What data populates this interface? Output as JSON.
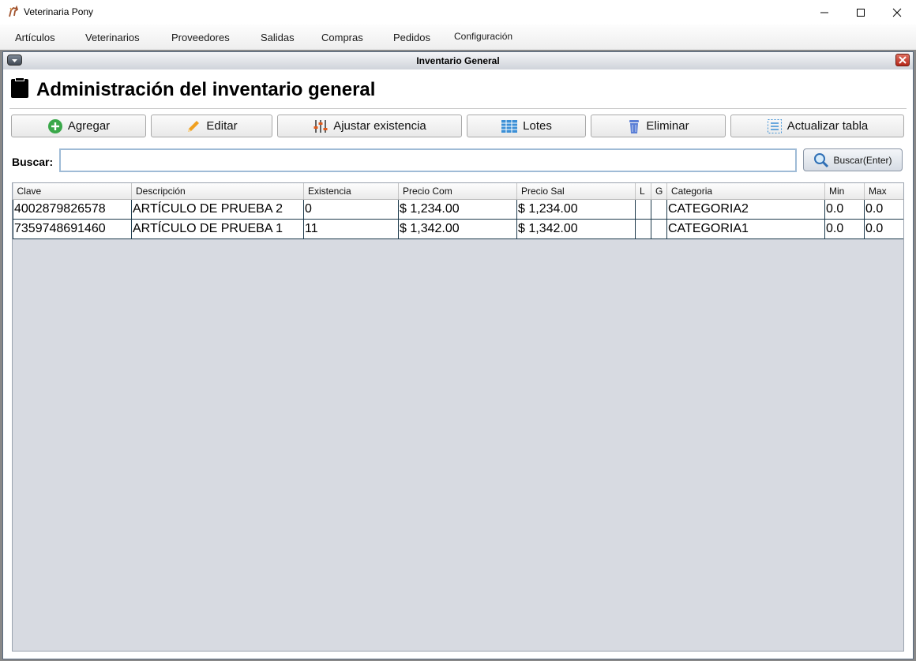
{
  "app": {
    "title": "Veterinaria Pony",
    "icon": "pony-icon"
  },
  "menubar": {
    "items": [
      "Artículos",
      "Veterinarios",
      "Proveedores",
      "Salidas",
      "Compras",
      "Pedidos",
      "Configuración"
    ]
  },
  "internal_frame": {
    "title": "Inventario General"
  },
  "header": {
    "title": "Administración del inventario general",
    "icon": "clipboard-icon"
  },
  "toolbar": {
    "agregar": "Agregar",
    "editar": "Editar",
    "ajustar": "Ajustar existencia",
    "lotes": "Lotes",
    "eliminar": "Eliminar",
    "actualizar": "Actualizar tabla"
  },
  "search": {
    "label": "Buscar:",
    "value": "",
    "button": "Buscar(Enter)"
  },
  "table": {
    "columns": [
      "Clave",
      "Descripción",
      "Existencia",
      "Precio Com",
      "Precio Sal",
      "L",
      "G",
      "Categoria",
      "Min",
      "Max"
    ],
    "rows": [
      [
        "4002879826578",
        "ARTÍCULO DE PRUEBA 2",
        "0",
        "$ 1,234.00",
        "$ 1,234.00",
        "",
        "",
        "CATEGORIA2",
        "0.0",
        "0.0"
      ],
      [
        "7359748691460",
        "ARTÍCULO DE PRUEBA 1",
        "11",
        "$ 1,342.00",
        "$ 1,342.00",
        "",
        "",
        "CATEGORIA1",
        "0.0",
        "0.0"
      ]
    ]
  },
  "colors": {
    "add": "#3aa84a",
    "edit": "#f0a020",
    "adjust": "#e05a1c",
    "lotes": "#3b8fd6",
    "delete": "#5b7fd6"
  }
}
